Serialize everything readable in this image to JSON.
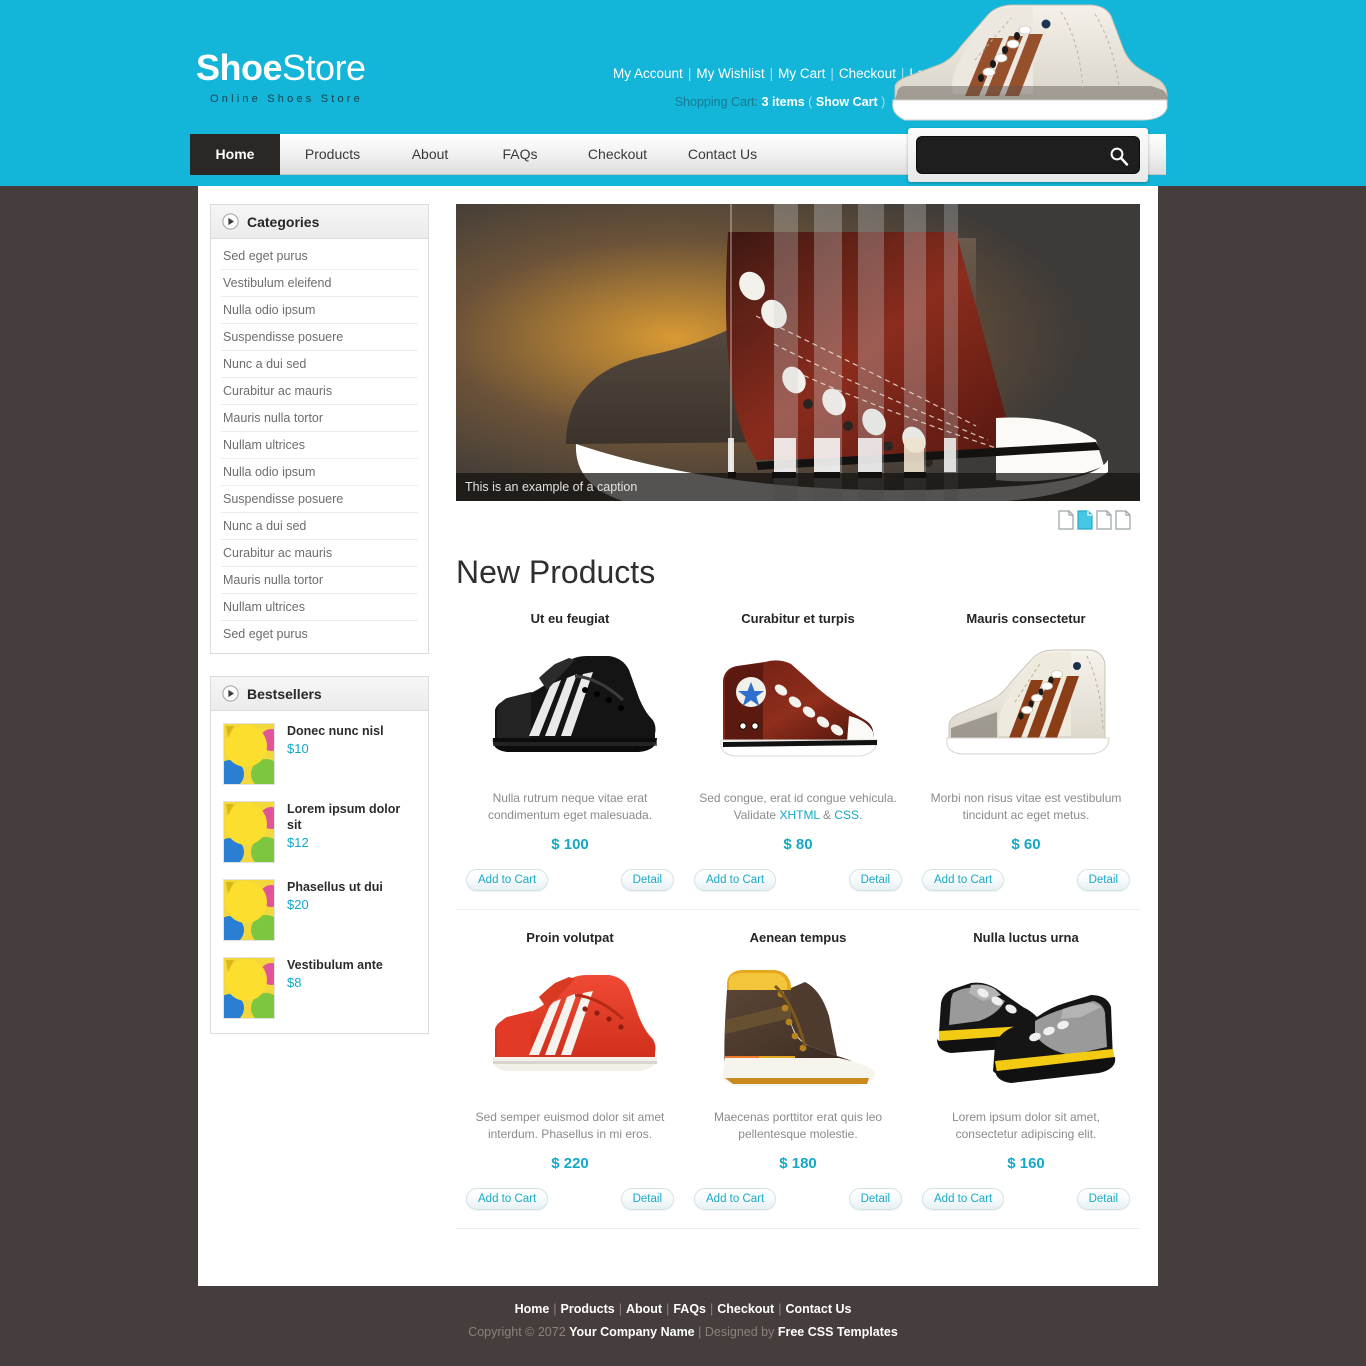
{
  "header": {
    "logo_bold": "Shoe",
    "logo_light": "Store",
    "tagline": "Online Shoes Store",
    "top_links": [
      "My Account",
      "My Wishlist",
      "My Cart",
      "Checkout",
      "Log In"
    ],
    "cart_label": "Shopping Cart:",
    "cart_items": "3 items",
    "cart_show": "Show Cart",
    "shoe_icon": "white-hightop-sneaker-image"
  },
  "nav": {
    "items": [
      {
        "label": "Home",
        "active": true
      },
      {
        "label": "Products",
        "active": false
      },
      {
        "label": "About",
        "active": false
      },
      {
        "label": "FAQs",
        "active": false
      },
      {
        "label": "Checkout",
        "active": false
      },
      {
        "label": "Contact Us",
        "active": false
      }
    ]
  },
  "search": {
    "value": "",
    "placeholder": "",
    "icon": "search-icon"
  },
  "sidebar": {
    "categories": {
      "title": "Categories",
      "icon": "play-arrow-icon",
      "items": [
        "Sed eget purus",
        "Vestibulum eleifend",
        "Nulla odio ipsum",
        "Suspendisse posuere",
        "Nunc a dui sed",
        "Curabitur ac mauris",
        "Mauris nulla tortor",
        "Nullam ultrices",
        "Nulla odio ipsum",
        "Suspendisse posuere",
        "Nunc a dui sed",
        "Curabitur ac mauris",
        "Mauris nulla tortor",
        "Nullam ultrices",
        "Sed eget purus"
      ]
    },
    "bestsellers": {
      "title": "Bestsellers",
      "icon": "play-arrow-icon",
      "items": [
        {
          "name": "Donec nunc nisl",
          "price": "$10",
          "thumb": "balloons-thumbnail"
        },
        {
          "name": "Lorem ipsum dolor sit",
          "price": "$12",
          "thumb": "balloons-thumbnail"
        },
        {
          "name": "Phasellus ut dui",
          "price": "$20",
          "thumb": "balloons-thumbnail"
        },
        {
          "name": "Vestibulum ante",
          "price": "$8",
          "thumb": "balloons-thumbnail"
        }
      ]
    }
  },
  "banner": {
    "caption": "This is an example of a caption",
    "image": "red-canvas-sneaker-banner",
    "pager": {
      "count": 4,
      "active_index": 1
    }
  },
  "main": {
    "section_title": "New Products",
    "buttons": {
      "add": "Add to Cart",
      "detail": "Detail"
    },
    "products": [
      {
        "name": "Ut eu feugiat",
        "desc": "Nulla rutrum neque vitae erat condimentum eget malesuada.",
        "price": "$ 100",
        "image": "black-sneaker-white-stripes"
      },
      {
        "name": "Curabitur et turpis",
        "desc_pre": "Sed congue, erat id congue vehicula. Validate ",
        "link1": "XHTML",
        "desc_mid": " & ",
        "link2": "CSS",
        "desc_post": ".",
        "price": "$ 80",
        "image": "maroon-hightop-star-sneaker"
      },
      {
        "name": "Mauris consectetur",
        "desc": "Morbi non risus vitae est vestibulum tincidunt ac eget metus.",
        "price": "$ 60",
        "image": "cream-hightop-brown-stripes"
      },
      {
        "name": "Proin volutpat",
        "desc": "Sed semper euismod dolor sit amet interdum. Phasellus in mi eros.",
        "price": "$ 220",
        "image": "red-sneaker-white-stripes"
      },
      {
        "name": "Aenean tempus",
        "desc": "Maecenas porttitor erat quis leo pellentesque molestie.",
        "price": "$ 180",
        "image": "brown-boot-yellow-collar"
      },
      {
        "name": "Nulla luctus urna",
        "desc": "Lorem ipsum dolor sit amet, consectetur adipiscing elit.",
        "price": "$ 160",
        "image": "gray-black-sneaker-pair"
      }
    ]
  },
  "footer": {
    "links": [
      "Home",
      "Products",
      "About",
      "FAQs",
      "Checkout",
      "Contact Us"
    ],
    "copyright_pre": "Copyright © 2072",
    "company": "Your Company Name",
    "designed_by": "Designed by",
    "designer": "Free CSS Templates"
  },
  "colors": {
    "accent_cyan": "#13b5d8",
    "price_cyan": "#14a8c8",
    "page_bg": "#463e3c",
    "nav_active": "#2b2724"
  }
}
